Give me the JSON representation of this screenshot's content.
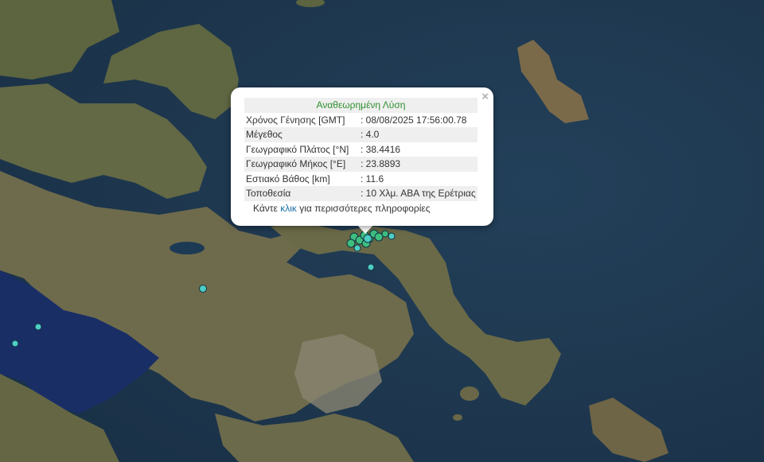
{
  "popup": {
    "title": "Αναθεωρημένη Λύση",
    "close_symbol": "×",
    "rows": [
      {
        "label": "Χρόνος Γένησης [GMT]",
        "value": ": 08/08/2025 17:56:00.78"
      },
      {
        "label": "Μέγεθος",
        "value": ": 4.0"
      },
      {
        "label": "Γεωγραφικό Πλάτος [°N]",
        "value": ": 38.4416"
      },
      {
        "label": "Γεωγραφικό Μήκος [°E]",
        "value": ": 23.8893"
      },
      {
        "label": "Εστιακό Βάθος [km]",
        "value": ": 11.6"
      },
      {
        "label": "Τοποθεσία",
        "value": ": 10 Χλμ. ΑΒΑ της Ερέτριας"
      }
    ],
    "more_prefix": "Κάντε",
    "more_link": "κλικ",
    "more_suffix": "για περισσότερες πληροφορίες"
  },
  "colors": {
    "sea": "#1f3a52",
    "land": "#6b6a4a",
    "marker_fill": "#4ecdc4",
    "marker_green": "#3fbf7f",
    "header_green": "#2f8f2f",
    "link": "#1a6fa8"
  }
}
